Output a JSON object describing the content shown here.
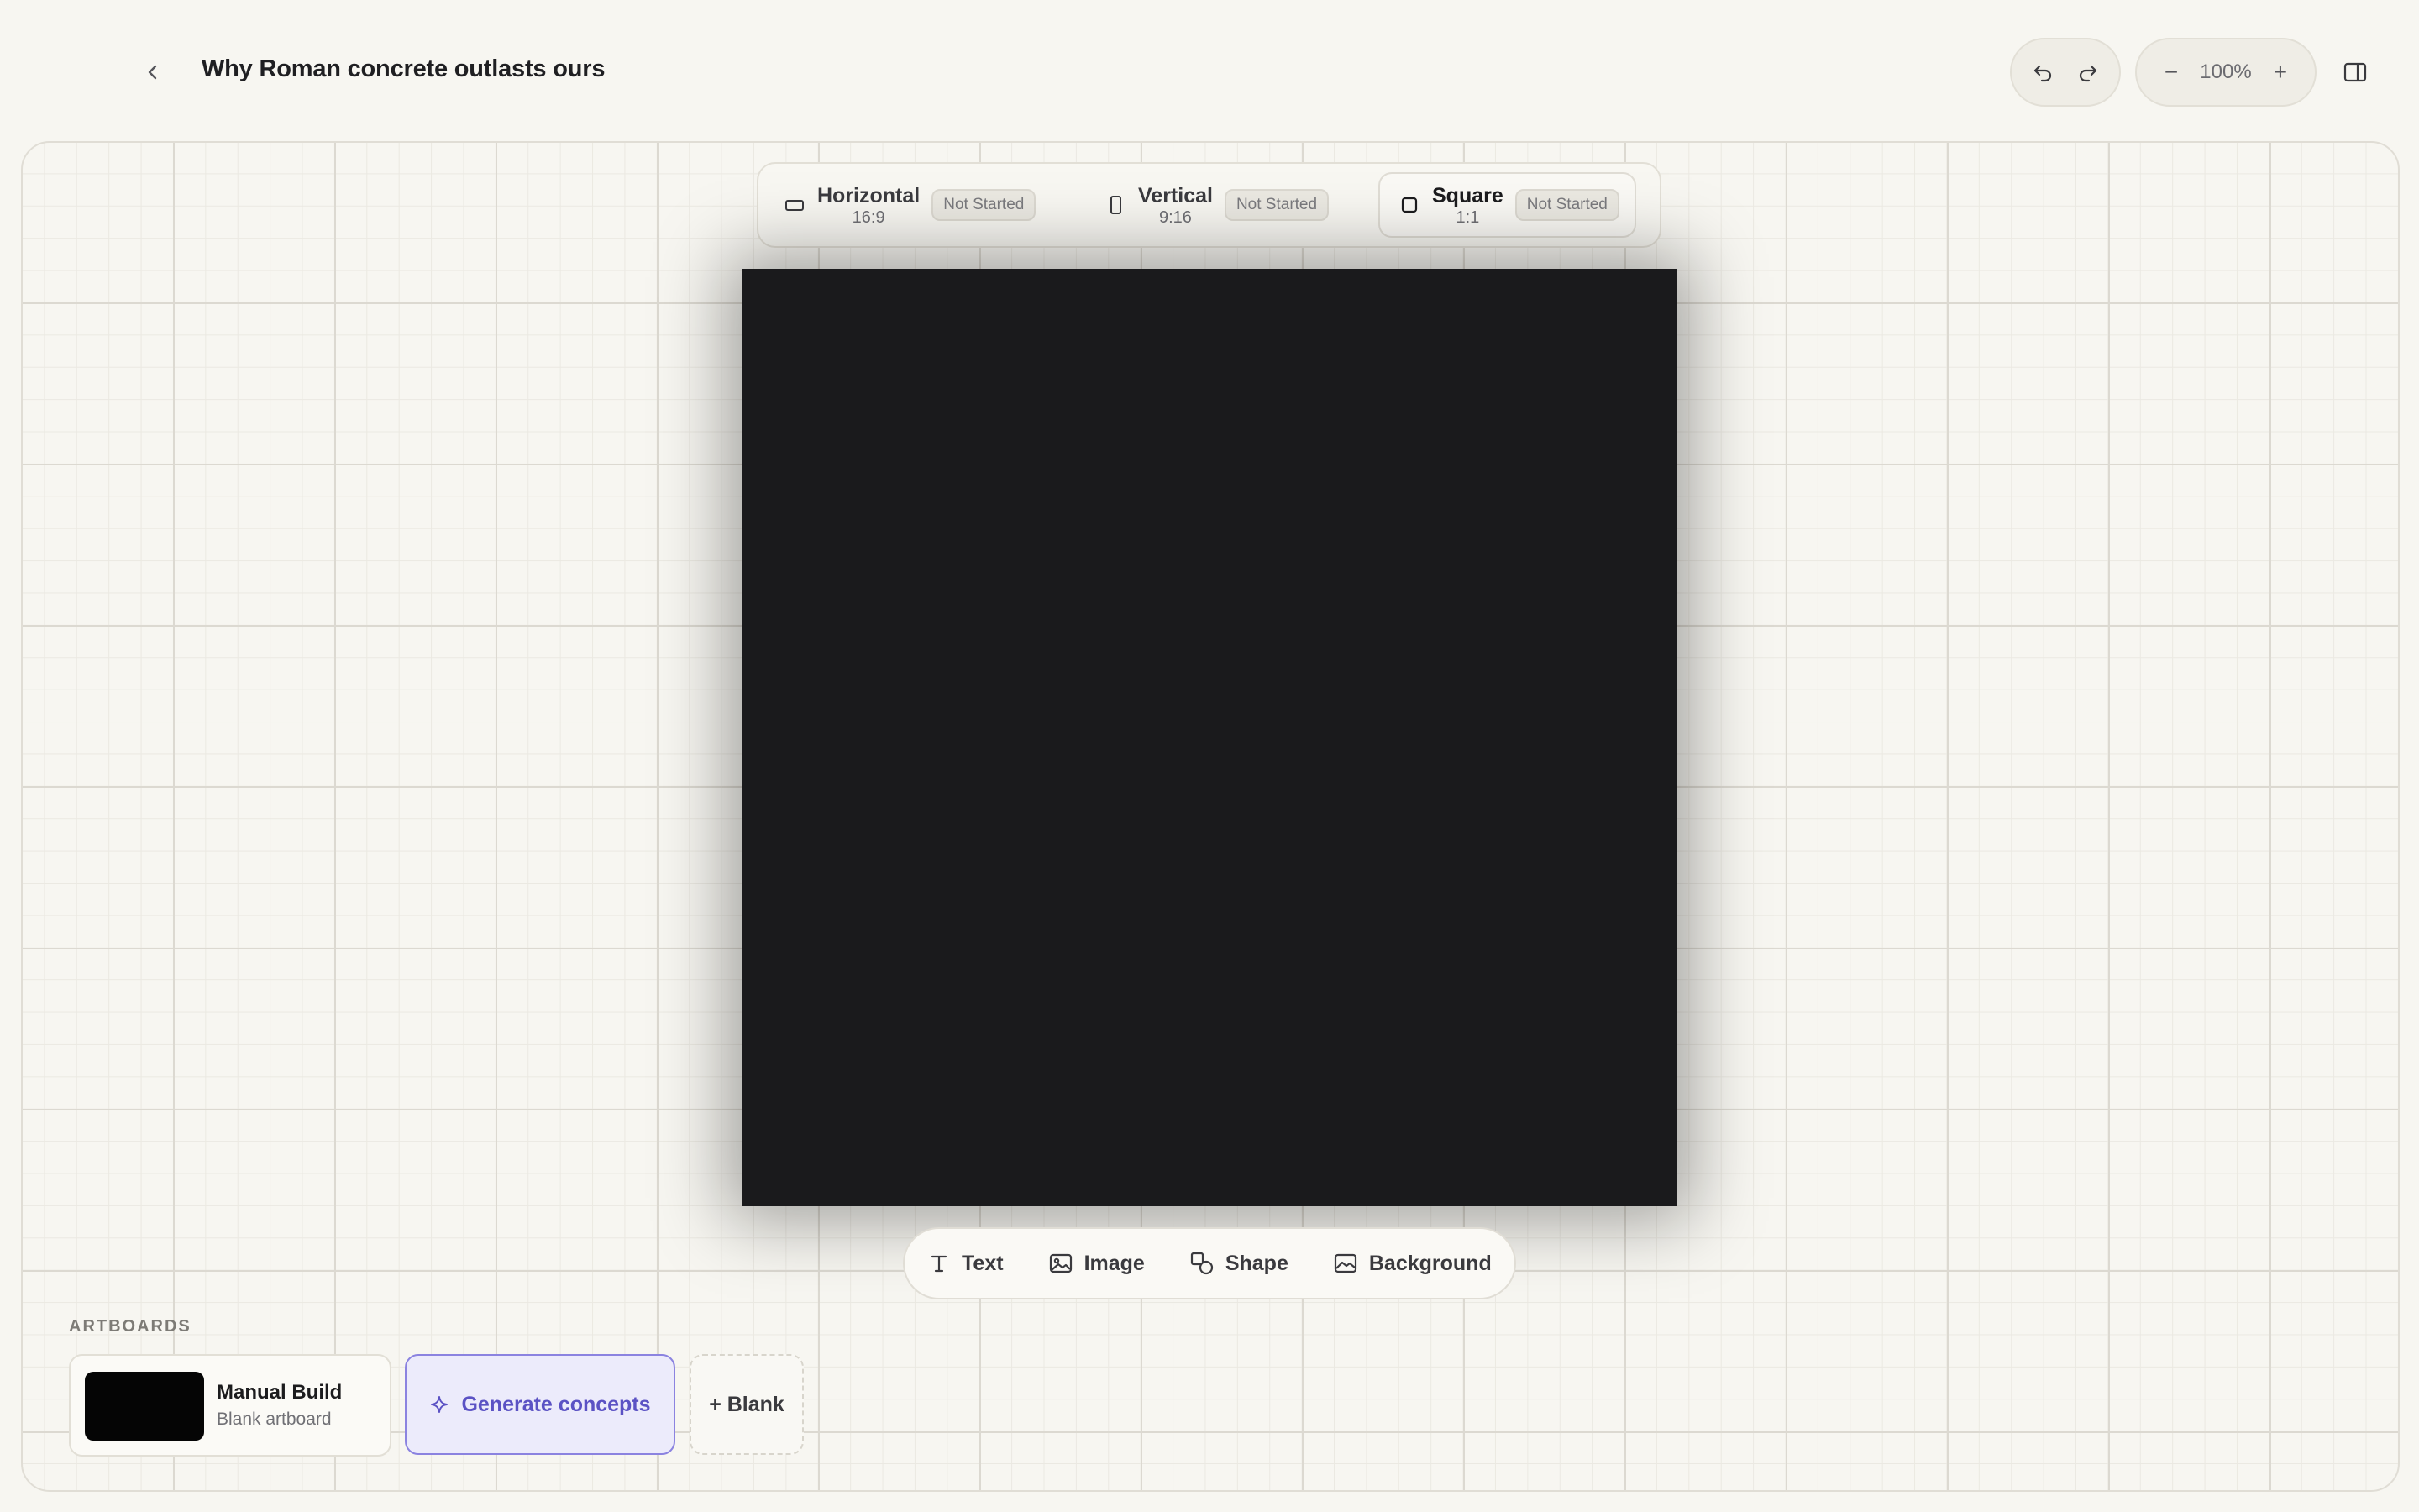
{
  "header": {
    "title": "Why Roman concrete outlasts ours",
    "back_icon": "chevron-left-icon",
    "undo_icon": "undo-icon",
    "redo_icon": "redo-icon",
    "zoom": {
      "minus": "−",
      "value": "100%",
      "plus": "+"
    },
    "panel_icon": "sidebar-toggle-icon"
  },
  "formats": [
    {
      "name": "Horizontal",
      "ratio": "16:9",
      "status": "Not Started",
      "icon": "landscape-rect-icon"
    },
    {
      "name": "Vertical",
      "ratio": "9:16",
      "status": "Not Started",
      "icon": "portrait-rect-icon"
    },
    {
      "name": "Square",
      "ratio": "1:1",
      "status": "Not Started",
      "icon": "square-icon",
      "selected": true
    }
  ],
  "tools": [
    {
      "label": "Text",
      "icon": "text-icon"
    },
    {
      "label": "Image",
      "icon": "image-icon"
    },
    {
      "label": "Shape",
      "icon": "shape-icon"
    },
    {
      "label": "Background",
      "icon": "background-icon"
    }
  ],
  "artboards": {
    "label": "ARTBOARDS",
    "items": [
      {
        "title": "Manual Build",
        "subtitle": "Blank artboard"
      }
    ],
    "generate_label": "Generate concepts",
    "blank_label": "+ Blank"
  },
  "colors": {
    "background": "#f7f6f1",
    "artboard": "#1a1a1c",
    "accent": "#5b52c4",
    "accent_bg": "#ecebfb"
  }
}
